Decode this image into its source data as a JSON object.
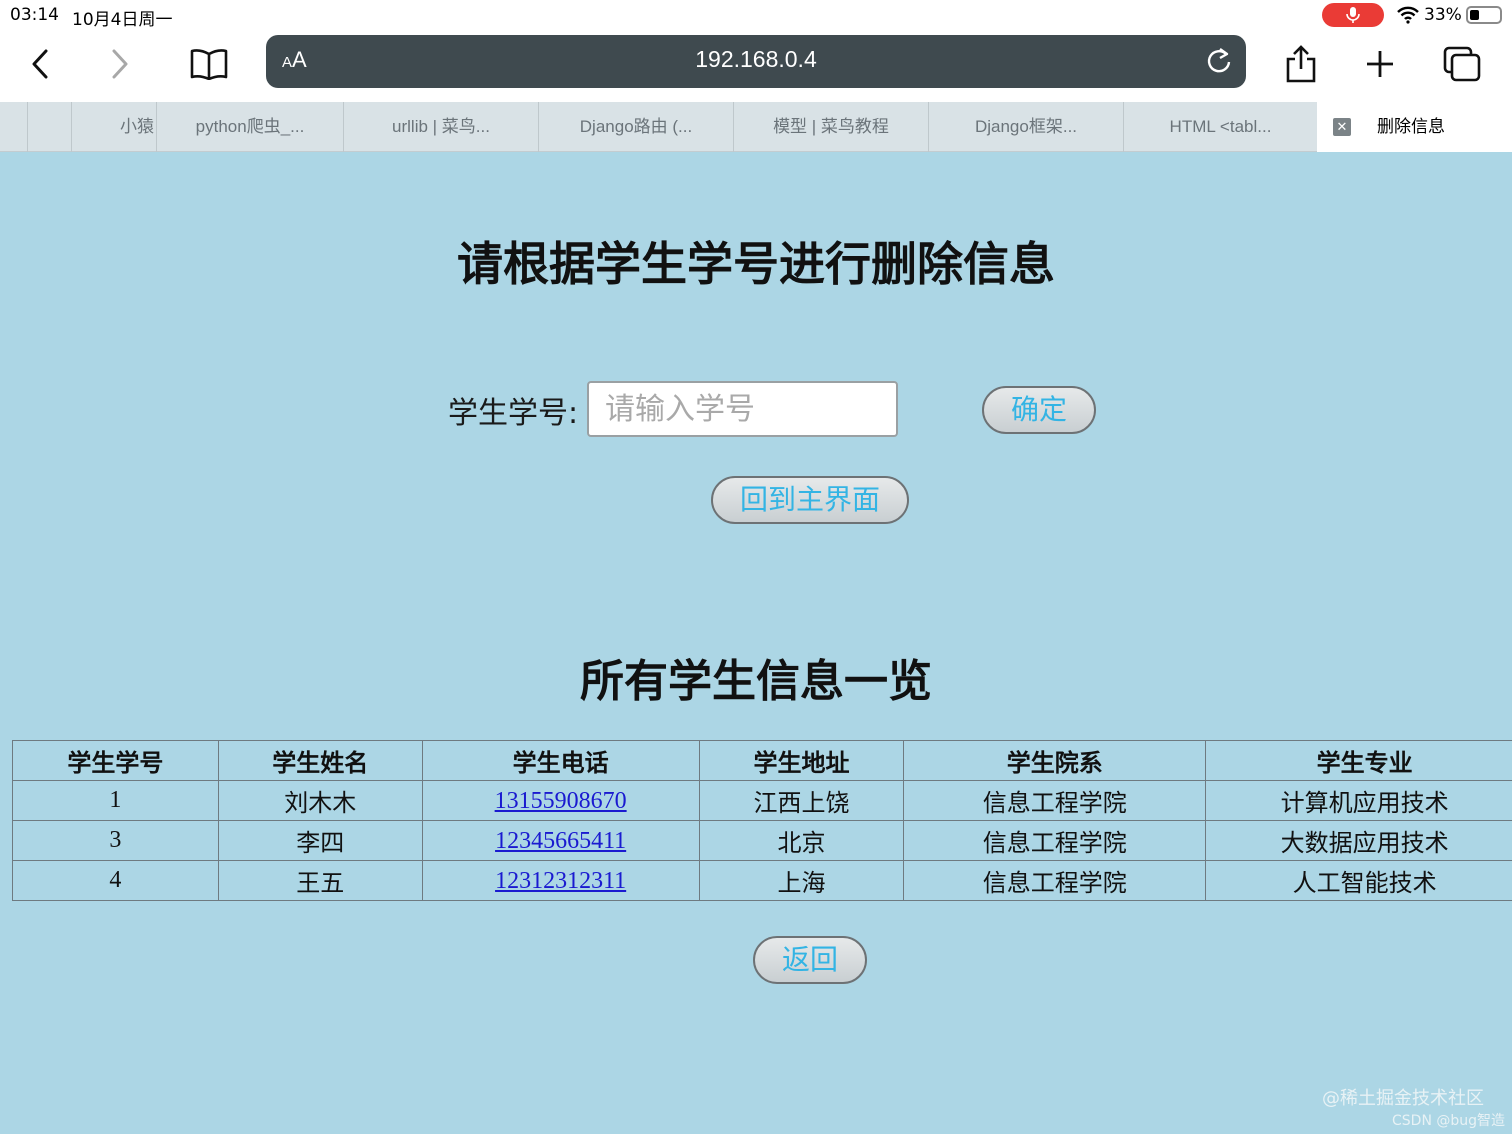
{
  "status_bar": {
    "time": "03:14",
    "date": "10月4日周一",
    "battery": "33%",
    "battery_level": 0.33
  },
  "toolbar": {
    "aa_label_small": "A",
    "aa_label_large": "A",
    "url": "192.168.0.4"
  },
  "tabs": [
    {
      "label": "小猿"
    },
    {
      "label": "python爬虫_..."
    },
    {
      "label": "urllib | 菜鸟..."
    },
    {
      "label": "Django路由 (..."
    },
    {
      "label": "模型 | 菜鸟教程"
    },
    {
      "label": "Django框架..."
    },
    {
      "label": "HTML <tabl..."
    },
    {
      "label": "删除信息",
      "active": true
    }
  ],
  "page": {
    "title": "请根据学生学号进行删除信息",
    "form_label": "学生学号:",
    "input_placeholder": "请输入学号",
    "confirm_label": "确定",
    "home_label": "回到主界面",
    "section_title": "所有学生信息一览",
    "back_label": "返回"
  },
  "table": {
    "headers": [
      "学生学号",
      "学生姓名",
      "学生电话",
      "学生地址",
      "学生院系",
      "学生专业"
    ],
    "rows": [
      [
        "1",
        "刘木木",
        "13155908670",
        "江西上饶",
        "信息工程学院",
        "计算机应用技术"
      ],
      [
        "3",
        "李四",
        "12345665411",
        "北京",
        "信息工程学院",
        "大数据应用技术"
      ],
      [
        "4",
        "王五",
        "12312312311",
        "上海",
        "信息工程学院",
        "人工智能技术"
      ]
    ]
  },
  "watermark": {
    "line1": "@稀土掘金技术社区",
    "line2": "CSDN @bug智造"
  },
  "colors": {
    "page_background": "#acd6e5",
    "button_text": "#33b4e4",
    "link": "#1a1ad0",
    "mic_pill": "#ea3b36"
  }
}
